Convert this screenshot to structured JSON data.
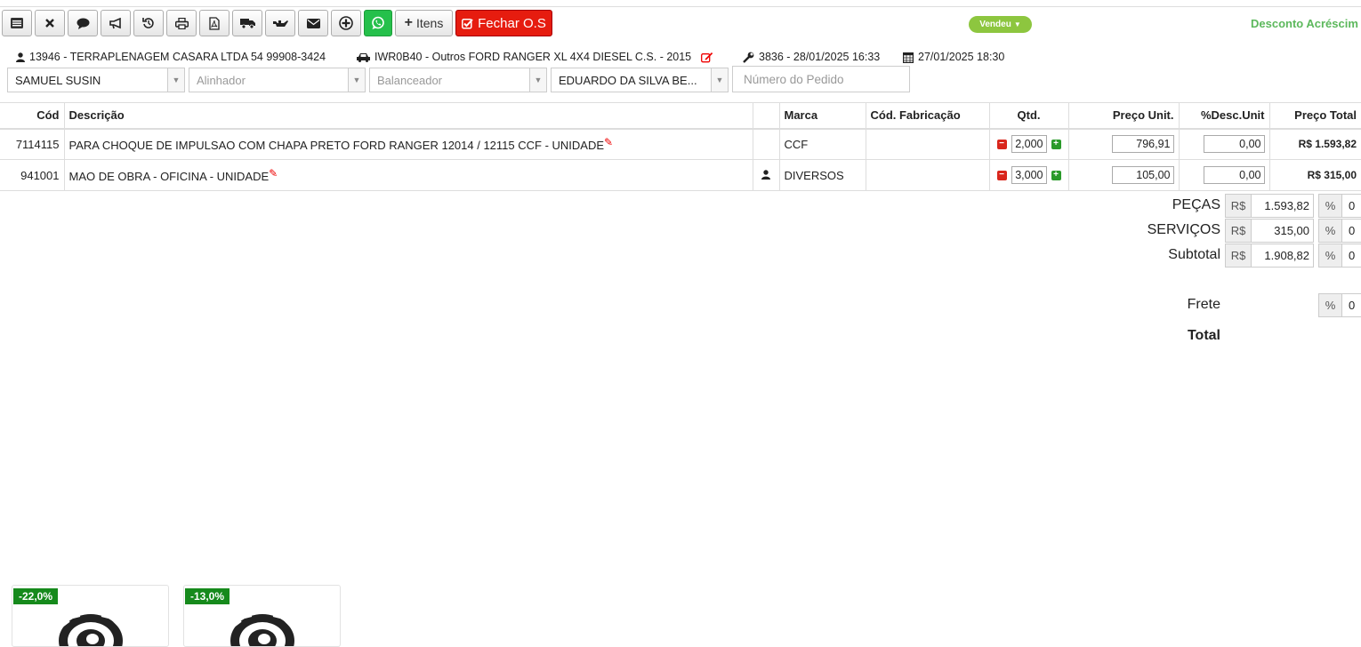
{
  "toolbar": {
    "buttons": [
      "list-icon",
      "close-icon",
      "comment-icon",
      "bullhorn-icon",
      "history-icon",
      "print-icon",
      "pdf-icon",
      "truck-icon",
      "oil-icon",
      "envelope-icon",
      "plus-circle-icon",
      "whatsapp-icon"
    ],
    "itens_label": "Itens",
    "fechar_label": "Fechar O.S"
  },
  "status": {
    "vendeu": "Vendeu",
    "desconto_acrescimo": "Desconto Acréscim"
  },
  "info": {
    "cliente": "13946 - TERRAPLENAGEM CASARA LTDA 54 99908-3424",
    "veiculo": "IWR0B40 - Outros FORD RANGER XL 4X4 DIESEL C.S. - 2015",
    "os": "3836 - 28/01/2025 16:33",
    "data": "27/01/2025 18:30"
  },
  "selects": {
    "vendedor": "SAMUEL SUSIN",
    "alinhador": "Alinhador",
    "balanceador": "Balanceador",
    "mecanico": "EDUARDO DA SILVA BE...",
    "pedido_placeholder": "Número do Pedido"
  },
  "table": {
    "headers": {
      "cod": "Cód",
      "descricao": "Descrição",
      "marca": "Marca",
      "cod_fab": "Cód. Fabricação",
      "qtd": "Qtd.",
      "preco_unit": "Preço Unit.",
      "desc_unit": "%Desc.Unit",
      "preco_total": "Preço Total"
    },
    "rows": [
      {
        "cod": "7114115",
        "descricao": "PARA CHOQUE DE IMPULSAO COM CHAPA PRETO FORD RANGER 12014 / 12115 CCF - UNIDADE",
        "marca": "CCF",
        "cod_fab": "",
        "qtd": "2,000",
        "preco_unit": "796,91",
        "desc": "0,00",
        "total": "R$ 1.593,82"
      },
      {
        "cod": "941001",
        "descricao": "MAO DE OBRA - OFICINA - UNIDADE",
        "marca": "DIVERSOS",
        "cod_fab": "",
        "qtd": "3,000",
        "preco_unit": "105,00",
        "desc": "0,00",
        "total": "R$ 315,00"
      }
    ]
  },
  "summary": {
    "currency": "R$",
    "pct": "%",
    "pecas_label": "PEÇAS",
    "pecas_value": "1.593,82",
    "servicos_label": "SERVIÇOS",
    "servicos_value": "315,00",
    "subtotal_label": "Subtotal",
    "subtotal_value": "1.908,82",
    "frete_label": "Frete",
    "total_label": "Total",
    "pct_value": "0"
  },
  "promos": [
    {
      "badge": "-22,0%"
    },
    {
      "badge": "-13,0%"
    }
  ],
  "colors": {
    "danger": "#e61c0f",
    "success": "#25c04b",
    "vendeu": "#8dc63f",
    "badge": "#168a1c"
  }
}
